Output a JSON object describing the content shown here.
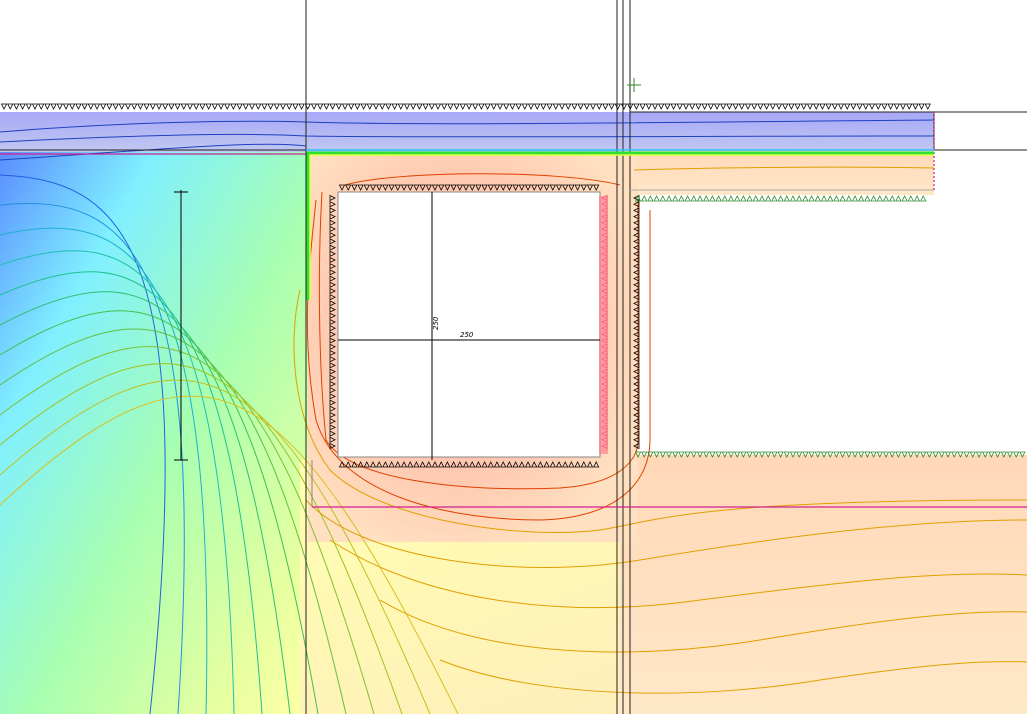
{
  "colors": {
    "cold": "#6a5cff",
    "cool": "#7ff0ff",
    "mid": "#9cff9c",
    "warm": "#ffff9c",
    "hot": "#ff6a5c",
    "boundary_inner": "#000000",
    "boundary_outer": "#2a8a2a",
    "boundary_heated": "#e0205a",
    "material_line": "#d02090",
    "isotherm_cold": "#2040c0",
    "isotherm_mid": "#30a030",
    "isotherm_warm": "#e0a000",
    "isotherm_hot": "#e04000"
  },
  "dimensions": {
    "top_left": "",
    "height_left": "",
    "opening_width": "250",
    "opening_height": "250",
    "left_wall": "",
    "right_wall": "",
    "ext_right_top": "",
    "ext_right_bottom": ""
  }
}
